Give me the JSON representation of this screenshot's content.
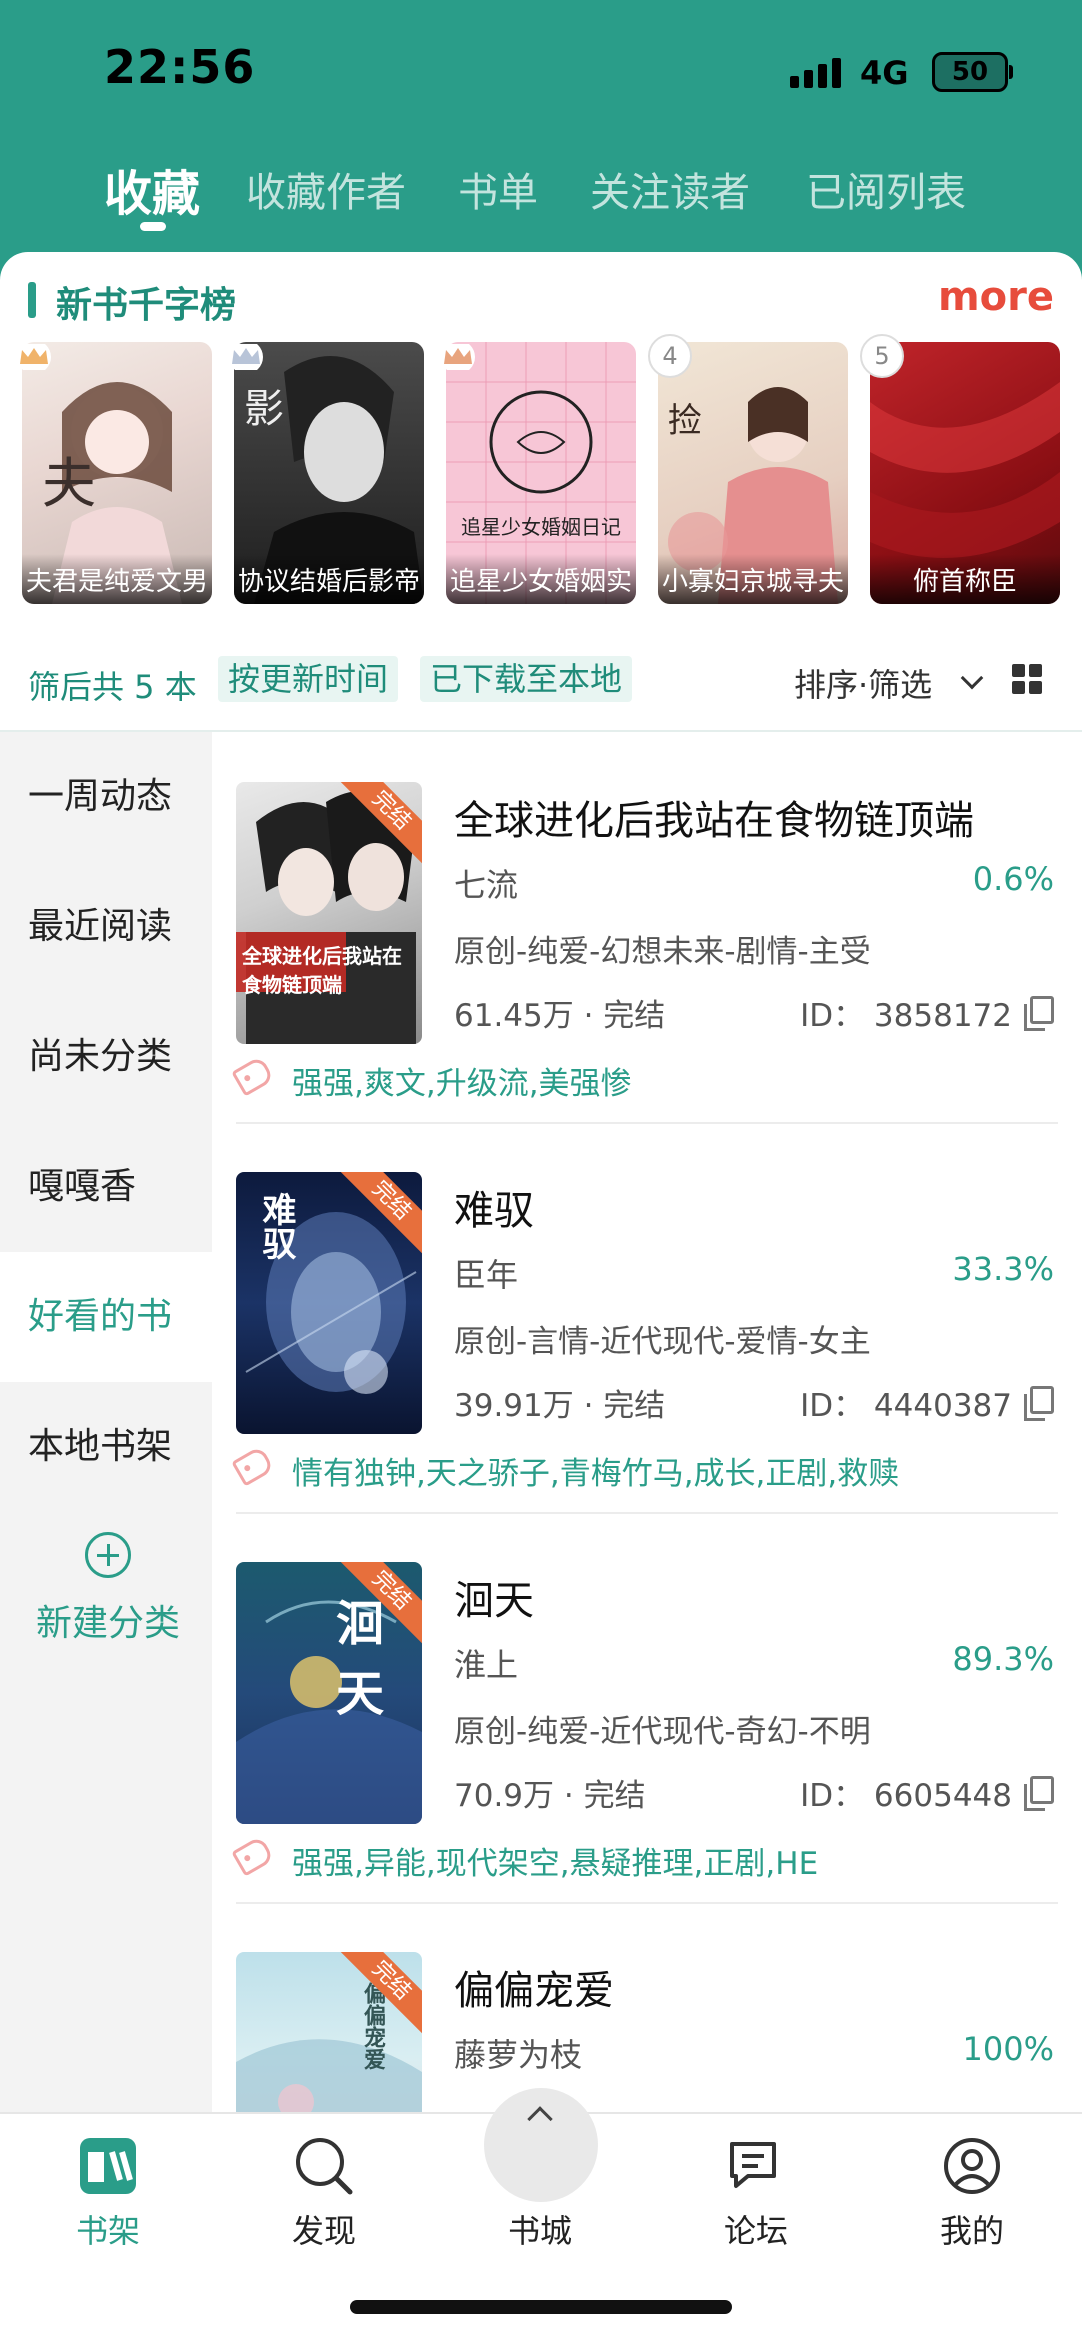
{
  "status": {
    "time": "22:56",
    "network": "4G",
    "battery": "50"
  },
  "tabs": [
    {
      "label": "收藏",
      "active": true
    },
    {
      "label": "收藏作者"
    },
    {
      "label": "书单"
    },
    {
      "label": "关注读者"
    },
    {
      "label": "已阅列表"
    }
  ],
  "ranking": {
    "title": "新书千字榜",
    "more": "more",
    "books": [
      {
        "rank": "1",
        "title": "夫君是纯爱文男"
      },
      {
        "rank": "2",
        "title": "协议结婚后影帝"
      },
      {
        "rank": "3",
        "title": "追星少女婚姻实"
      },
      {
        "rank": "4",
        "title": "小寡妇京城寻夫"
      },
      {
        "rank": "5",
        "title": "俯首称臣"
      }
    ],
    "cover_texts": [
      "夫君",
      "影帝",
      "追星少女婚姻日记",
      "捡个夫君",
      "俯首称臣"
    ]
  },
  "filter": {
    "count": "筛后共 5 本",
    "chip_sort": "按更新时间",
    "chip_downloaded": "已下载至本地",
    "sort_filter": "排序·筛选"
  },
  "sidebar": {
    "items": [
      {
        "label": "一周动态"
      },
      {
        "label": "最近阅读"
      },
      {
        "label": "尚未分类"
      },
      {
        "label": "嘎嘎香"
      },
      {
        "label": "好看的书",
        "active": true
      },
      {
        "label": "本地书架"
      }
    ],
    "new_category": "新建分类"
  },
  "list": [
    {
      "title": "全球进化后我站在食物链顶端",
      "author": "七流",
      "progress": "0.6%",
      "genre": "原创-纯爱-幻想未来-剧情-主受",
      "meta": "61.45万 · 完结",
      "id": "ID： 3858172",
      "tags": "强强,爽文,升级流,美强惨",
      "ribbon": "完结",
      "cover_text": "全球进化后我站在食物链顶端"
    },
    {
      "title": "难驭",
      "author": "臣年",
      "progress": "33.3%",
      "genre": "原创-言情-近代现代-爱情-女主",
      "meta": "39.91万 · 完结",
      "id": "ID： 4440387",
      "tags": "情有独钟,天之骄子,青梅竹马,成长,正剧,救赎",
      "ribbon": "完结",
      "cover_text": "难驭"
    },
    {
      "title": "洄天",
      "author": "淮上",
      "progress": "89.3%",
      "genre": "原创-纯爱-近代现代-奇幻-不明",
      "meta": "70.9万 · 完结",
      "id": "ID： 6605448",
      "tags": "强强,异能,现代架空,悬疑推理,正剧,HE",
      "ribbon": "完结",
      "cover_text": "洄天"
    },
    {
      "title": "偏偏宠爱",
      "author": "藤萝为枝",
      "progress": "100%",
      "ribbon": "完结",
      "cover_text": "偏偏宠爱"
    }
  ],
  "bottom_nav": [
    {
      "label": "书架",
      "icon": "bookshelf-icon",
      "active": true
    },
    {
      "label": "发现",
      "icon": "search-icon"
    },
    {
      "label": "书城",
      "icon": "book-icon"
    },
    {
      "label": "论坛",
      "icon": "chat-icon"
    },
    {
      "label": "我的",
      "icon": "user-icon"
    }
  ],
  "colors": {
    "accent": "#2a9d89",
    "more": "#e74c3c",
    "ribbon": "#e76f3c"
  }
}
